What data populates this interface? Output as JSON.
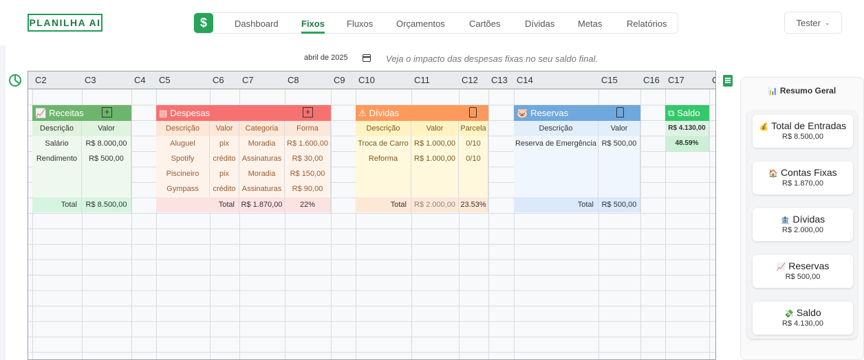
{
  "app": {
    "logo": "PLANILHA AI",
    "user": "Tester"
  },
  "nav": {
    "icon": "$",
    "items": [
      {
        "label": "Dashboard"
      },
      {
        "label": "Fixos"
      },
      {
        "label": "Fluxos"
      },
      {
        "label": "Orçamentos"
      },
      {
        "label": "Cartões"
      },
      {
        "label": "Dívidas"
      },
      {
        "label": "Metas"
      },
      {
        "label": "Relatórios"
      }
    ]
  },
  "toolbar": {
    "month": "abril de 2025",
    "hint": "Veja o impacto das despesas fixas no seu saldo final."
  },
  "sheet": {
    "columns": [
      "C2",
      "C3",
      "C4",
      "C5",
      "C6",
      "C7",
      "C8",
      "C9",
      "C10",
      "C11",
      "C12",
      "C13",
      "C14",
      "C15",
      "C16",
      "C17",
      "C"
    ]
  },
  "receitas": {
    "title": "Receitas",
    "headers": [
      "Descrição",
      "Valor"
    ],
    "rows": [
      [
        "Salário",
        "R$ 8.000,00"
      ],
      [
        "Rendimento",
        "R$ 500,00"
      ],
      [
        "",
        ""
      ],
      [
        "",
        ""
      ]
    ],
    "total_label": "Total",
    "total_value": "R$ 8.500,00"
  },
  "despesas": {
    "title": "Despesas",
    "headers": [
      "Descrição",
      "Valor",
      "Categoria",
      "Forma"
    ],
    "rows": [
      [
        "Aluguel",
        "pix",
        "Moradia",
        "R$ 1.600,00"
      ],
      [
        "Spotify",
        "crédito",
        "Assinaturas",
        "R$ 30,00"
      ],
      [
        "Piscineiro",
        "pix",
        "Moradia",
        "R$ 150,00"
      ],
      [
        "Gympass",
        "crédito",
        "Assinaturas",
        "R$ 90,00"
      ]
    ],
    "total_label": "Total",
    "total_value": "R$ 1.870,00",
    "total_pct": "22%"
  },
  "dividas": {
    "title": "Dívidas",
    "headers": [
      "Descrição",
      "Valor",
      "Parcela"
    ],
    "rows": [
      [
        "Troca de Carro",
        "R$ 1.000,00",
        "0/10"
      ],
      [
        "Reforma",
        "R$ 1.000,00",
        "0/10"
      ],
      [
        "",
        "",
        ""
      ],
      [
        "",
        "",
        ""
      ]
    ],
    "total_label": "Total",
    "total_value": "R$ 2.000,00",
    "total_pct": "23.53%"
  },
  "reservas": {
    "title": "Reservas",
    "headers": [
      "Descrição",
      "Valor"
    ],
    "rows": [
      [
        "Reserva de Emergência",
        "R$ 500,00"
      ],
      [
        "",
        ""
      ],
      [
        "",
        ""
      ],
      [
        "",
        ""
      ]
    ],
    "total_label": "Total",
    "total_value": "R$ 500,00"
  },
  "saldo": {
    "title": "Saldo",
    "value": "R$ 4.130,00",
    "pct": "48.59%"
  },
  "resumo": {
    "title": "Resumo Geral",
    "title_icon": "📊",
    "cards": [
      {
        "icon": "💰",
        "title": "Total de Entradas",
        "value": "R$ 8.500,00"
      },
      {
        "icon": "🏠",
        "title": "Contas Fixas",
        "value": "R$ 1.870,00"
      },
      {
        "icon": "🏦",
        "title": "Dívidas",
        "value": "R$ 2.000,00"
      },
      {
        "icon": "📈",
        "title": "Reservas",
        "value": "R$ 500,00"
      },
      {
        "icon": "💸",
        "title": "Saldo",
        "value": "R$ 4.130,00"
      }
    ]
  },
  "colors": {
    "brand": "#27a35a",
    "receitas": "#6db56d",
    "despesas": "#f87171",
    "dividas": "#fb9a5c",
    "reservas": "#6fa8dc",
    "saldo": "#34c86a"
  }
}
